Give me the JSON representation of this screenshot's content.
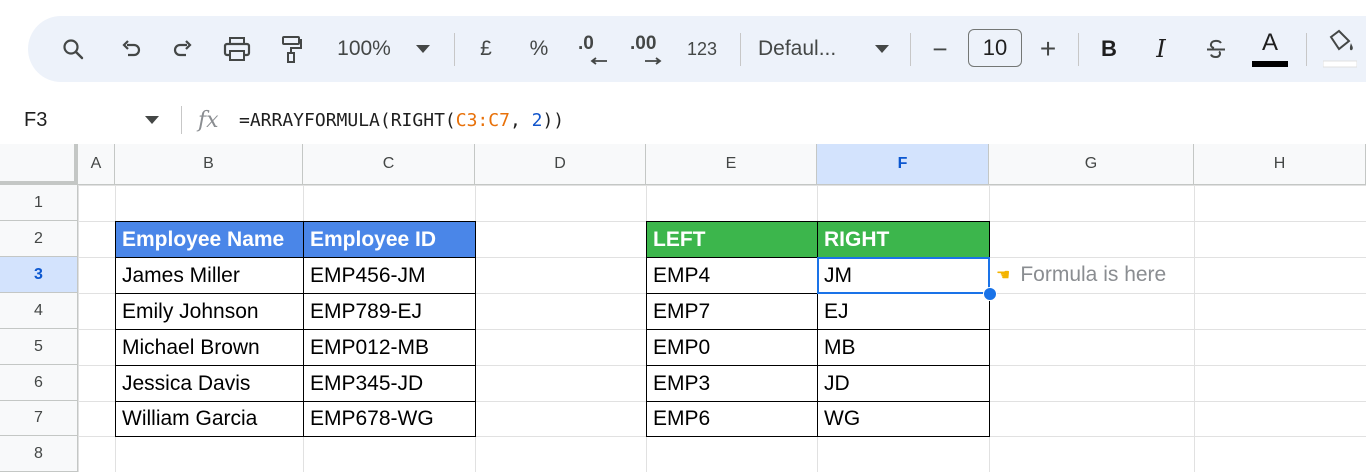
{
  "toolbar": {
    "zoom": "100%",
    "currency": "£",
    "percent": "%",
    "decrease_decimal": ".0",
    "increase_decimal": ".00",
    "number_format": "123",
    "font": "Defaul...",
    "font_size": "10",
    "minus": "−",
    "plus": "+",
    "bold": "B",
    "italic": "I",
    "text_color": "A",
    "icons": [
      "search-icon",
      "undo-icon",
      "redo-icon",
      "print-icon",
      "paint-format-icon",
      "chevron-down-icon",
      "strikethrough-icon",
      "fill-color-icon"
    ]
  },
  "formula_bar": {
    "name_box": "F3",
    "fx": "fx",
    "formula_prefix": "=ARRAYFORMULA(RIGHT(",
    "formula_range": "C3:C7",
    "formula_sep": ", ",
    "formula_num": "2",
    "formula_suffix": "))"
  },
  "columns": [
    "A",
    "B",
    "C",
    "D",
    "E",
    "F",
    "G",
    "H"
  ],
  "rows": [
    "1",
    "2",
    "3",
    "4",
    "5",
    "6",
    "7",
    "8"
  ],
  "selected": {
    "column": "F",
    "row": "3"
  },
  "employees_table": {
    "headers": [
      "Employee Name",
      "Employee ID"
    ],
    "rows": [
      [
        "James Miller",
        "EMP456-JM"
      ],
      [
        "Emily Johnson",
        "EMP789-EJ"
      ],
      [
        "Michael Brown",
        "EMP012-MB"
      ],
      [
        "Jessica Davis",
        "EMP345-JD"
      ],
      [
        "William Garcia",
        "EMP678-WG"
      ]
    ]
  },
  "result_table": {
    "headers": [
      "LEFT",
      "RIGHT"
    ],
    "rows": [
      [
        "EMP4",
        "JM"
      ],
      [
        "EMP7",
        "EJ"
      ],
      [
        "EMP0",
        "MB"
      ],
      [
        "EMP3",
        "JD"
      ],
      [
        "EMP6",
        "WG"
      ]
    ]
  },
  "note": {
    "text": "Formula is here",
    "icon": "pointing-hand-icon"
  },
  "colors": {
    "header_blue": "#4a86e8",
    "header_green": "#3cb64c",
    "selection": "#1a73e8",
    "formula_range": "#e8710a",
    "formula_number": "#1155cc"
  }
}
